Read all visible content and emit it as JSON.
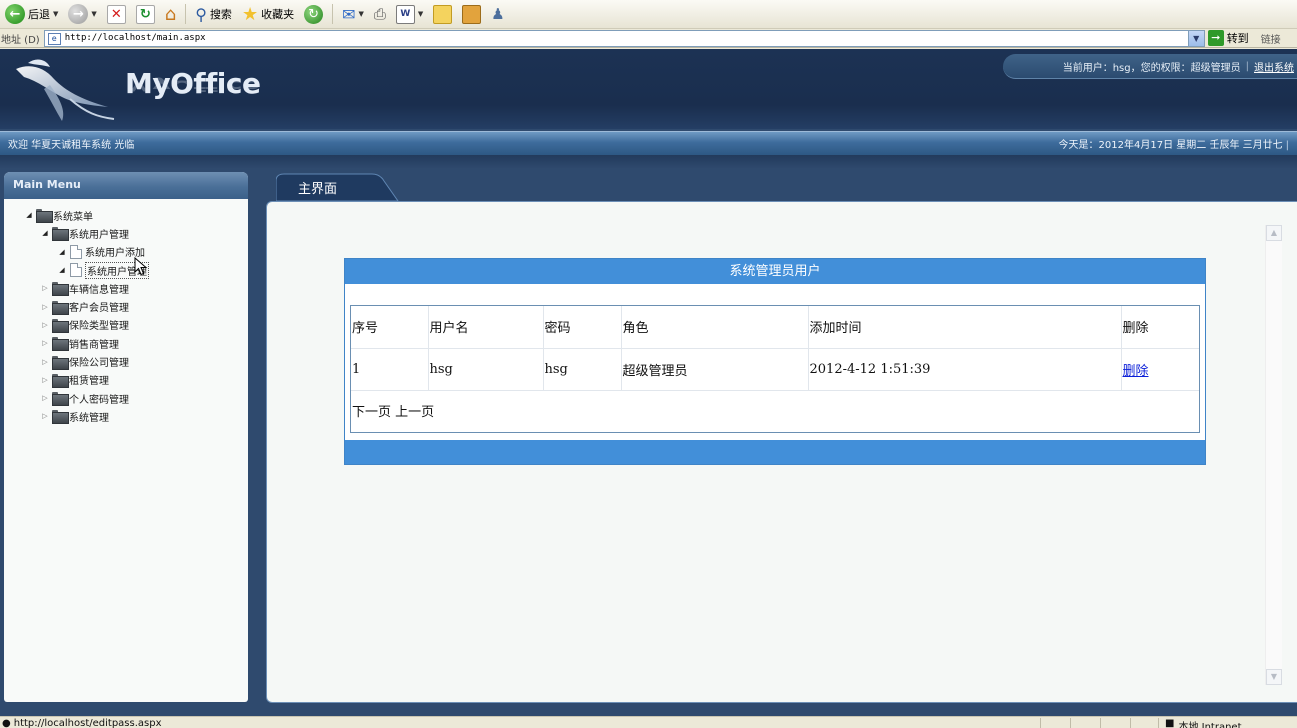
{
  "browser": {
    "toolbar": {
      "back_label": "后退",
      "search_label": "搜索",
      "favorites_label": "收藏夹"
    },
    "address": {
      "label": "地址 (D)",
      "url": "http://localhost/main.aspx",
      "go_label": "转到",
      "links_label": "链接"
    },
    "status": {
      "url": "http://localhost/editpass.aspx",
      "zone": "本地 Intranet"
    }
  },
  "header": {
    "logo": "MyOffice",
    "user_info": "当前用户：hsg，您的权限：超级管理员",
    "logout": "退出系统"
  },
  "welcome": {
    "left": "欢迎 华夏天诚租车系统 光临",
    "date": "今天是：2012年4月17日 星期二 壬辰年 三月廿七"
  },
  "menu": {
    "title": "Main Menu",
    "root": "系统菜单",
    "items": [
      {
        "label": "系统用户管理",
        "children": [
          "系统用户添加",
          "系统用户管理"
        ]
      },
      {
        "label": "车辆信息管理"
      },
      {
        "label": "客户会员管理"
      },
      {
        "label": "保险类型管理"
      },
      {
        "label": "销售商管理"
      },
      {
        "label": "保险公司管理"
      },
      {
        "label": "租赁管理"
      },
      {
        "label": "个人密码管理"
      },
      {
        "label": "系统管理"
      }
    ]
  },
  "main": {
    "tab_label": "主界面",
    "grid": {
      "title": "系统管理员用户",
      "columns": [
        "序号",
        "用户名",
        "密码",
        "角色",
        "添加时间",
        "删除"
      ],
      "rows": [
        {
          "id": "1",
          "username": "hsg",
          "password": "hsg",
          "role": "超级管理员",
          "added": "2012-4-12 1:51:39",
          "delete_label": "删除"
        }
      ],
      "pager": {
        "next": "下一页",
        "prev": "上一页"
      }
    }
  },
  "colors": {
    "header_bg": "#1c3254",
    "grid_blue": "#428fd9",
    "link": "#0b1fd8"
  },
  "icons": [
    "back-icon",
    "forward-icon",
    "stop-icon",
    "refresh-icon",
    "home-icon",
    "search-icon",
    "favorites-star-icon",
    "history-icon",
    "mail-icon",
    "print-icon",
    "edit-icon",
    "folder-icon",
    "page-icon"
  ]
}
